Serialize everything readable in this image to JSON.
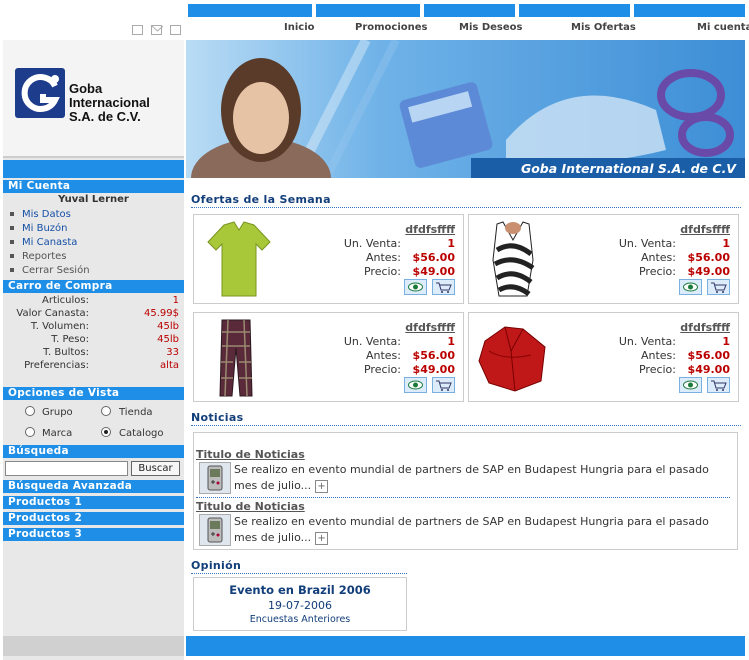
{
  "top_nav": {
    "links": [
      "Inicio",
      "Promociones",
      "Mis Deseos",
      "Mis Ofertas",
      "Mi cuenta"
    ]
  },
  "brand": {
    "line1": "Goba",
    "line2": "Internacional",
    "line3": "S.A. de C.V.",
    "banner_caption": "Goba International S.A. de C.V"
  },
  "sidebar": {
    "mi_cuenta": {
      "title": "Mi Cuenta",
      "user": "Yuval Lerner",
      "items": [
        "Mis Datos",
        "Mi Buzón",
        "Mi Canasta",
        "Reportes",
        "Cerrar Sesión"
      ]
    },
    "carro": {
      "title": "Carro de Compra",
      "rows": [
        {
          "label": "Articulos:",
          "value": "1"
        },
        {
          "label": "Valor Canasta:",
          "value": "45.99$"
        },
        {
          "label": "T. Volumen:",
          "value": "45lb"
        },
        {
          "label": "T. Peso:",
          "value": "45lb"
        },
        {
          "label": "T. Bultos:",
          "value": "33"
        },
        {
          "label": "Preferencias:",
          "value": "alta"
        }
      ]
    },
    "opciones": {
      "title": "Opciones de Vista",
      "options": [
        "Grupo",
        "Tienda",
        "Marca",
        "Catalogo"
      ],
      "selected": "Catalogo"
    },
    "busqueda": {
      "title": "Búsqueda",
      "button": "Buscar",
      "placeholder": ""
    },
    "links": [
      "Búsqueda Avanzada",
      "Productos 1",
      "Productos 2",
      "Productos 3"
    ]
  },
  "ofertas": {
    "title": "Ofertas de la Semana",
    "labels": {
      "venta": "Un. Venta:",
      "antes": "Antes:",
      "precio": "Precio:"
    },
    "products": [
      {
        "name": "dfdfsffff",
        "venta": "1",
        "antes": "$56.00",
        "precio": "$49.00",
        "image": "green-polo-shirt"
      },
      {
        "name": "dfdfsffff",
        "venta": "1",
        "antes": "$56.00",
        "precio": "$49.00",
        "image": "striped-halter-top"
      },
      {
        "name": "dfdfsffff",
        "venta": "1",
        "antes": "$56.00",
        "precio": "$49.00",
        "image": "plaid-pants"
      },
      {
        "name": "dfdfsffff",
        "venta": "1",
        "antes": "$56.00",
        "precio": "$49.00",
        "image": "red-jacket"
      }
    ]
  },
  "noticias": {
    "title": "Noticias",
    "items": [
      {
        "title": "Titulo de Noticias",
        "body_line1": "Se realizo en evento mundial de partners de SAP en Budapest Hungria para el pasado",
        "body_line2": "mes de julio...",
        "more": "+"
      },
      {
        "title": "Titulo de Noticias",
        "body_line1": "Se realizo en evento mundial de partners de SAP en Budapest Hungria para el pasado",
        "body_line2": "mes de julio...",
        "more": "+"
      }
    ]
  },
  "opinion": {
    "title": "Opinión",
    "event": "Evento en Brazil 2006",
    "date": "19-07-2006",
    "link": "Encuestas Anteriores"
  },
  "colors": {
    "accent": "#1e8ee6",
    "price": "#bb0000",
    "title": "#123e7a"
  }
}
